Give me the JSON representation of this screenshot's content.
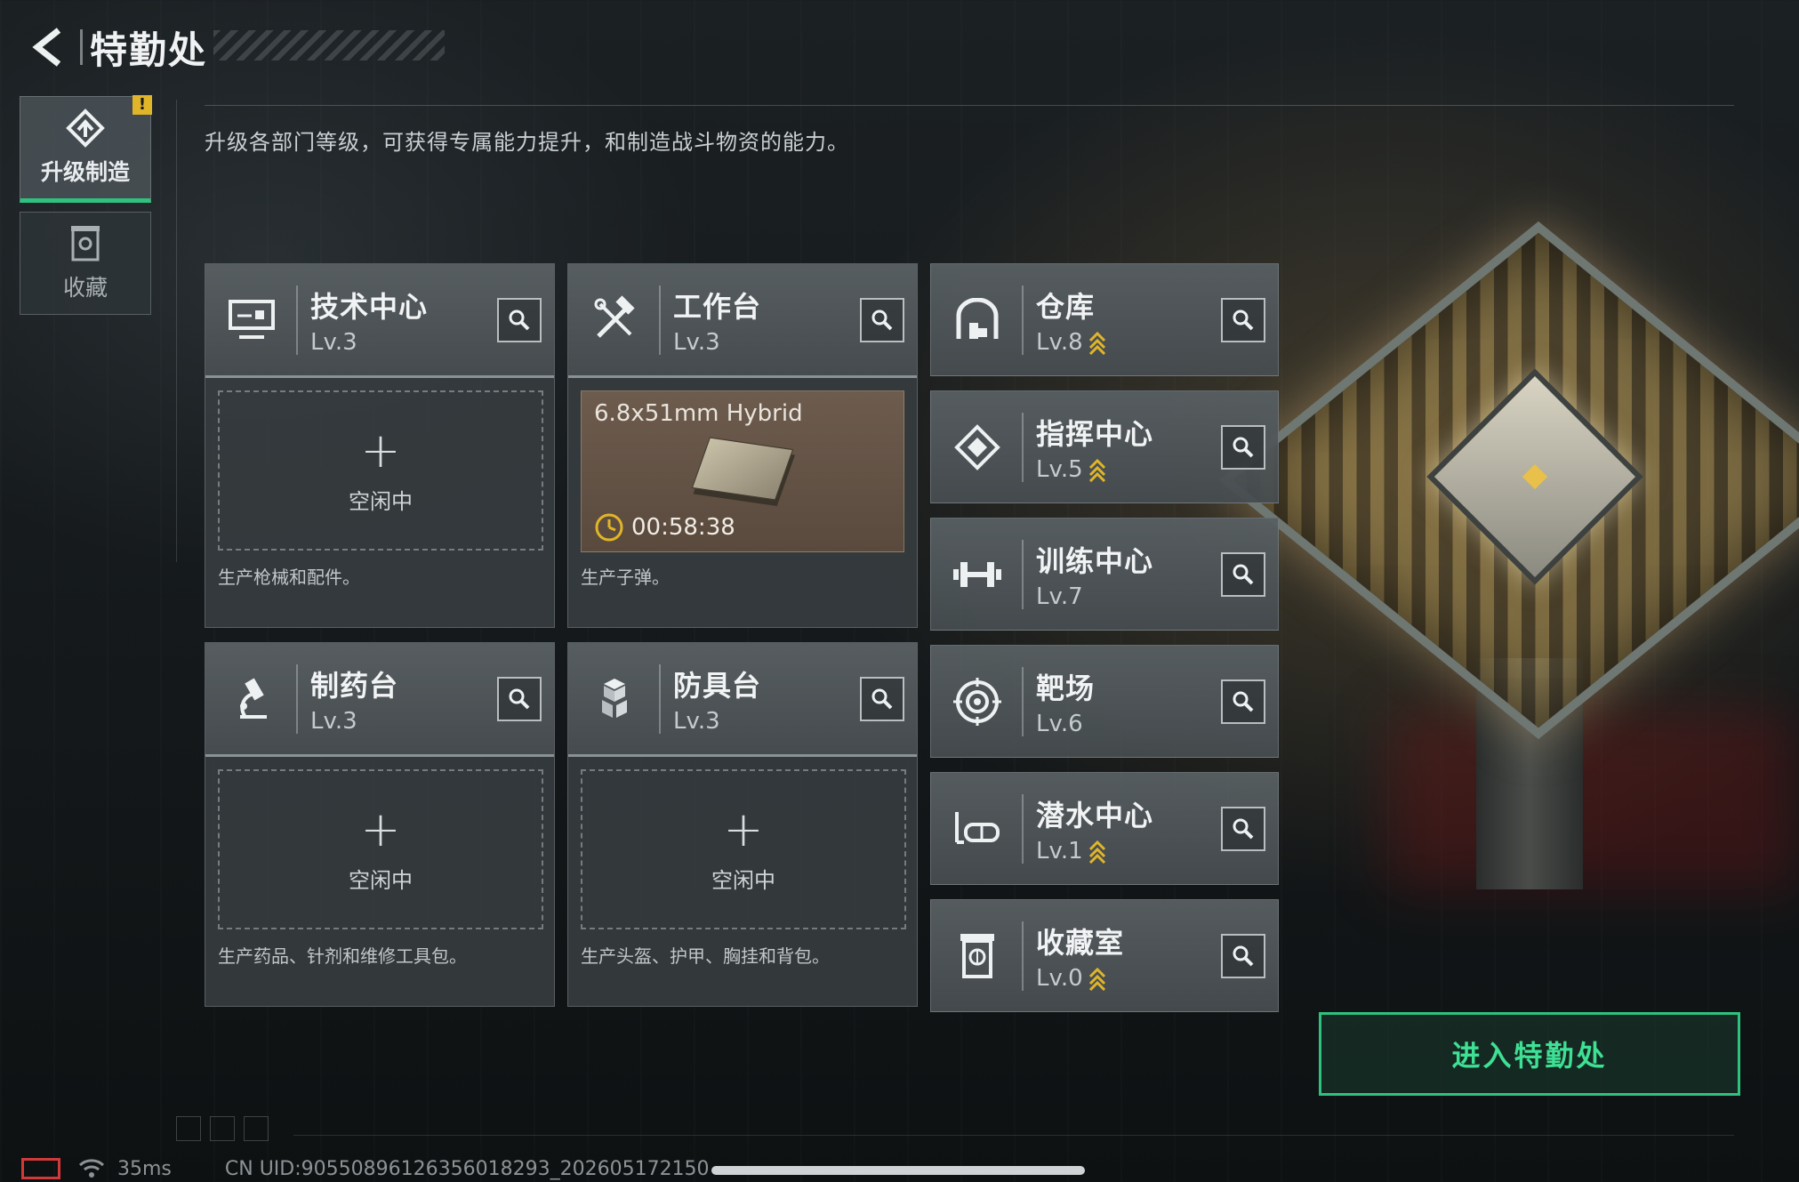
{
  "header": {
    "title": "特勤处",
    "back_icon": "chevron-left-icon"
  },
  "sidebar": {
    "items": [
      {
        "label": "升级制造",
        "icon": "upgrade-icon",
        "active": true,
        "badge": "!"
      },
      {
        "label": "收藏",
        "icon": "collection-icon",
        "active": false
      }
    ]
  },
  "description": "升级各部门等级，可获得专属能力提升，和制造战斗物资的能力。",
  "facilities": [
    {
      "name": "技术中心",
      "level": "Lv.3",
      "icon": "computer-icon",
      "upgradable": false,
      "slot_plus": "+",
      "slot_status": "空闲中",
      "note": "生产枪械和配件。"
    },
    {
      "name": "工作台",
      "level": "Lv.3",
      "icon": "tools-icon",
      "upgradable": false,
      "production": {
        "item": "6.8x51mm Hybrid",
        "timer": "00:58:38"
      },
      "note": "生产子弹。"
    },
    {
      "name": "制药台",
      "level": "Lv.3",
      "icon": "microscope-icon",
      "upgradable": false,
      "slot_plus": "+",
      "slot_status": "空闲中",
      "note": "生产药品、针剂和维修工具包。"
    },
    {
      "name": "防具台",
      "level": "Lv.3",
      "icon": "armor-icon",
      "upgradable": false,
      "slot_plus": "+",
      "slot_status": "空闲中",
      "note": "生产头盔、护甲、胸挂和背包。"
    }
  ],
  "side_facilities": [
    {
      "name": "仓库",
      "level": "Lv.8",
      "icon": "warehouse-icon",
      "upgradable": true
    },
    {
      "name": "指挥中心",
      "level": "Lv.5",
      "icon": "command-icon",
      "upgradable": true
    },
    {
      "name": "训练中心",
      "level": "Lv.7",
      "icon": "dumbbell-icon",
      "upgradable": false
    },
    {
      "name": "靶场",
      "level": "Lv.6",
      "icon": "target-icon",
      "upgradable": false
    },
    {
      "name": "潜水中心",
      "level": "Lv.1",
      "icon": "diving-mask-icon",
      "upgradable": true
    },
    {
      "name": "收藏室",
      "level": "Lv.0",
      "icon": "collection-icon",
      "upgradable": true
    }
  ],
  "enter_button": "进入特勤处",
  "status_bar": {
    "ping": "35ms",
    "uid": "CN UID:90550896126356018293_202605172150"
  },
  "colors": {
    "accent": "#2ec27e",
    "upgrade": "#e0b52a",
    "panel": "#363c3f"
  }
}
